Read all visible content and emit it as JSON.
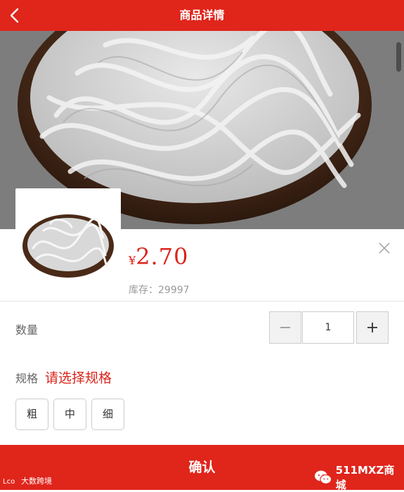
{
  "header": {
    "title": "商品详情",
    "back_icon": "chevron-left-icon"
  },
  "product": {
    "currency_symbol": "¥",
    "price": "2.70",
    "stock_text": "库存：29997"
  },
  "quantity": {
    "label": "数量",
    "value": "1"
  },
  "spec": {
    "label": "规格",
    "prompt": "请选择规格",
    "options": [
      "粗",
      "中",
      "细"
    ]
  },
  "confirm_label": "确认",
  "watermark": {
    "left_text": "大数跨境",
    "right_text": "511MXZ商城"
  },
  "colors": {
    "brand_red": "#e0251b",
    "price_red": "#d9261c"
  }
}
